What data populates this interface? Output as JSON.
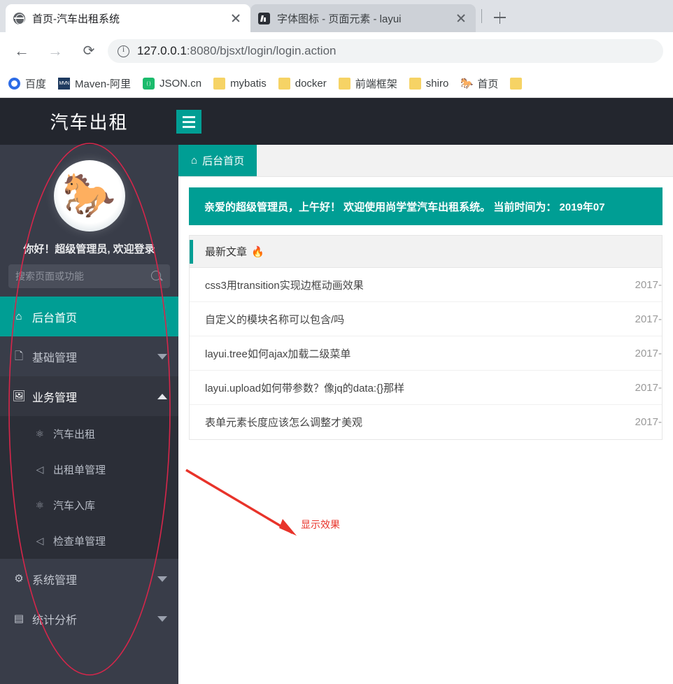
{
  "browser": {
    "tabs": [
      {
        "title": "首页-汽车出租系统",
        "favicon": "globe-icon",
        "active": true
      },
      {
        "title": "字体图标 - 页面元素 - layui",
        "favicon": "layui-icon",
        "active": false
      }
    ],
    "new_tab_label": "+",
    "nav": {
      "back": "←",
      "forward": "→",
      "reload": "⟳"
    },
    "address": {
      "host": "127.0.0.1",
      "path": ":8080/bjsxt/login/login.action"
    },
    "bookmarks": [
      {
        "label": "百度",
        "icon": "baidu-icon"
      },
      {
        "label": "Maven-阿里",
        "icon": "maven-icon"
      },
      {
        "label": "JSON.cn",
        "icon": "json-icon"
      },
      {
        "label": "mybatis",
        "icon": "folder-icon"
      },
      {
        "label": "docker",
        "icon": "folder-icon"
      },
      {
        "label": "前端框架",
        "icon": "folder-icon"
      },
      {
        "label": "shiro",
        "icon": "folder-icon"
      },
      {
        "label": "首页",
        "icon": "horse-icon"
      }
    ]
  },
  "app": {
    "logo": "汽车出租",
    "menu_toggle": "hamburger-icon",
    "colors": {
      "accent": "#009e94",
      "sidebar": "#393d49",
      "header": "#23262e",
      "annotation": "#e8332a"
    }
  },
  "sidebar": {
    "avatar": "horse-avatar",
    "avatar_glyph": "🐎",
    "greeting": "你好！超级管理员, 欢迎登录",
    "search": {
      "placeholder": "搜索页面或功能",
      "value": ""
    },
    "menu": [
      {
        "label": "后台首页",
        "icon": "home-icon",
        "glyph": "⌂",
        "state": "active",
        "arrow": ""
      },
      {
        "label": "基础管理",
        "icon": "note-icon",
        "glyph": "🗋",
        "state": "collapsed",
        "arrow": "down"
      },
      {
        "label": "业务管理",
        "icon": "image-icon",
        "glyph": "🖼",
        "state": "expanded",
        "arrow": "up",
        "children": [
          {
            "label": "汽车出租",
            "icon": "cluster-icon",
            "glyph": "⚛"
          },
          {
            "label": "出租单管理",
            "icon": "paper-plane-icon",
            "glyph": "◁"
          },
          {
            "label": "汽车入库",
            "icon": "cluster-icon",
            "glyph": "⚛"
          },
          {
            "label": "检查单管理",
            "icon": "paper-plane-icon",
            "glyph": "◁"
          }
        ]
      },
      {
        "label": "系统管理",
        "icon": "gear-icon",
        "glyph": "⚙",
        "state": "collapsed",
        "arrow": "down"
      },
      {
        "label": "统计分析",
        "icon": "chart-icon",
        "glyph": "▤",
        "state": "collapsed",
        "arrow": "down"
      }
    ]
  },
  "content": {
    "tabs": [
      {
        "label": "后台首页",
        "icon": "home-icon",
        "glyph": "⌂",
        "active": true
      }
    ],
    "banner": "亲爱的超级管理员，上午好！ 欢迎使用尚学堂汽车出租系统。 当前时间为： 2019年07",
    "panel": {
      "title": "最新文章",
      "badge": "🔥",
      "articles": [
        {
          "title": "css3用transition实现边框动画效果",
          "date": "2017-"
        },
        {
          "title": "自定义的模块名称可以包含/吗",
          "date": "2017-"
        },
        {
          "title": "layui.tree如何ajax加载二级菜单",
          "date": "2017-"
        },
        {
          "title": "layui.upload如何带参数？像jq的data:{}那样",
          "date": "2017-"
        },
        {
          "title": "表单元素长度应该怎么调整才美观",
          "date": "2017-"
        }
      ]
    }
  },
  "annotations": {
    "arrow_label": "显示效果",
    "ellipse": "sidebar-highlight-ellipse",
    "color": "#e8332a"
  }
}
